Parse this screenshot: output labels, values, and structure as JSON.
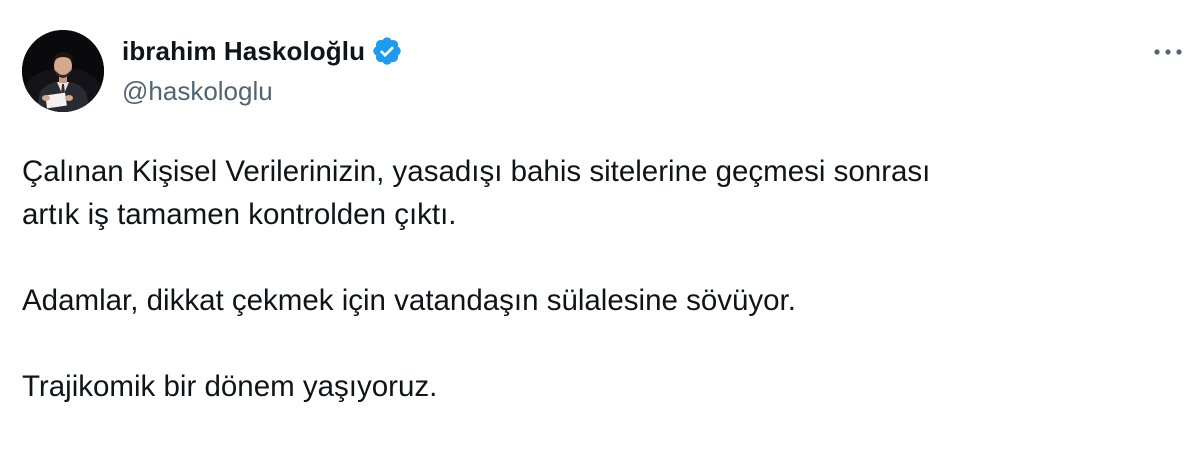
{
  "author": {
    "display_name": "ibrahim Haskoloğlu",
    "handle": "@haskologlu",
    "verified": true,
    "avatar_icon": "profile-photo",
    "verified_icon": "verified-badge-icon",
    "verified_color": "#1d9bf0"
  },
  "menu": {
    "icon": "more-horizontal-icon"
  },
  "tweet": {
    "paragraphs": [
      "Çalınan Kişisel Verilerinizin, yasadışı bahis sitelerine geçmesi sonrası",
      "artık iş tamamen kontrolden çıktı.",
      "Adamlar, dikkat çekmek için vatandaşın sülalesine sövüyor.",
      "Trajikomik bir dönem yaşıyoruz."
    ]
  },
  "colors": {
    "text": "#0f1419",
    "secondary": "#536471",
    "background": "#ffffff"
  }
}
